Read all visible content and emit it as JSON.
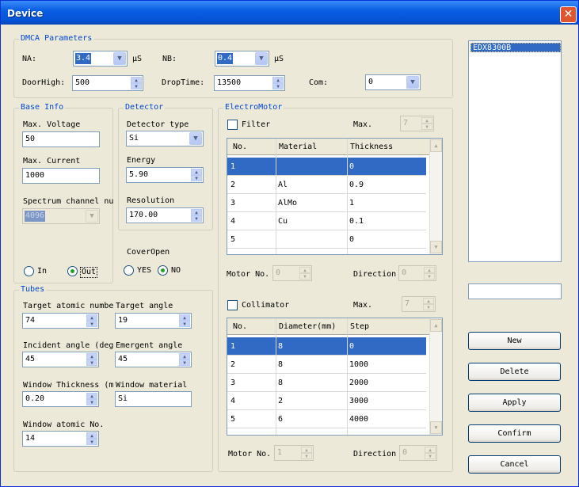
{
  "window": {
    "title": "Device",
    "close_glyph": "✕"
  },
  "dmca": {
    "title": "DMCA Parameters",
    "na_label": "NA:",
    "na_value": "3.4",
    "na_unit": "μS",
    "nb_label": "NB:",
    "nb_value": "0.4",
    "nb_unit": "μS",
    "doorhigh_label": "DoorHigh:",
    "doorhigh_value": "500",
    "droptime_label": "DropTime:",
    "droptime_value": "13500",
    "com_label": "Com:",
    "com_value": "0"
  },
  "base_info": {
    "title": "Base Info",
    "voltage_label": "Max. Voltage",
    "voltage_value": "50",
    "current_label": "Max. Current",
    "current_value": "1000",
    "channel_label": "Spectrum channel nu",
    "channel_value": "4096",
    "in_label": "In",
    "out_label": "Out"
  },
  "detector": {
    "title": "Detector",
    "type_label": "Detector type",
    "type_value": "Si",
    "energy_label": "Energy",
    "energy_value": "5.90",
    "resolution_label": "Resolution",
    "resolution_value": "170.00"
  },
  "cover": {
    "label": "CoverOpen",
    "yes_label": "YES",
    "no_label": "NO"
  },
  "tubes": {
    "title": "Tubes",
    "target_no_label": "Target atomic numbe",
    "target_no_value": "74",
    "target_angle_label": "Target angle",
    "target_angle_value": "19",
    "incident_label": "Incident angle (deg",
    "incident_value": "45",
    "emergent_label": "Emergent angle",
    "emergent_value": "45",
    "thickness_label": "Window Thickness (m",
    "thickness_value": "0.20",
    "material_label": "Window material",
    "material_value": "Si",
    "window_no_label": "Window atomic No.",
    "window_no_value": "14"
  },
  "electromotor": {
    "title": "ElectroMotor",
    "filter_label": "Filter",
    "filter_max_label": "Max.",
    "filter_max_value": "7",
    "filter_columns": [
      "No.",
      "Material",
      "Thickness"
    ],
    "filter_rows": [
      [
        "1",
        "",
        "0"
      ],
      [
        "2",
        "Al",
        "0.9"
      ],
      [
        "3",
        "AlMo",
        "1"
      ],
      [
        "4",
        "Cu",
        "0.1"
      ],
      [
        "5",
        "",
        "0"
      ]
    ],
    "motor_no_label": "Motor No.",
    "motor_no_value": "0",
    "direction_label": "Direction",
    "direction_value": "0",
    "collimator_label": "Collimator",
    "coll_max_label": "Max.",
    "coll_max_value": "7",
    "coll_columns": [
      "No.",
      "Diameter(mm)",
      "Step"
    ],
    "coll_rows": [
      [
        "1",
        "8",
        "0"
      ],
      [
        "2",
        "8",
        "1000"
      ],
      [
        "3",
        "8",
        "2000"
      ],
      [
        "4",
        "2",
        "3000"
      ],
      [
        "5",
        "6",
        "4000"
      ]
    ],
    "motor2_no_label": "Motor No.",
    "motor2_no_value": "1",
    "direction2_label": "Direction",
    "direction2_value": "0"
  },
  "device_list": {
    "items": [
      "EDX8300B"
    ]
  },
  "name_input": {
    "value": ""
  },
  "buttons": {
    "new": "New",
    "delete": "Delete",
    "apply": "Apply",
    "confirm": "Confirm",
    "cancel": "Cancel"
  },
  "icons": {
    "spin_up": "▲",
    "spin_down": "▼",
    "dropdown": "▼",
    "scroll_up": "▲",
    "scroll_down": "▼"
  },
  "colors": {
    "title_bar": "#0a5fe4",
    "group_title": "#0046d5",
    "selection": "#316ac5",
    "radio_dot": "#21a121"
  }
}
